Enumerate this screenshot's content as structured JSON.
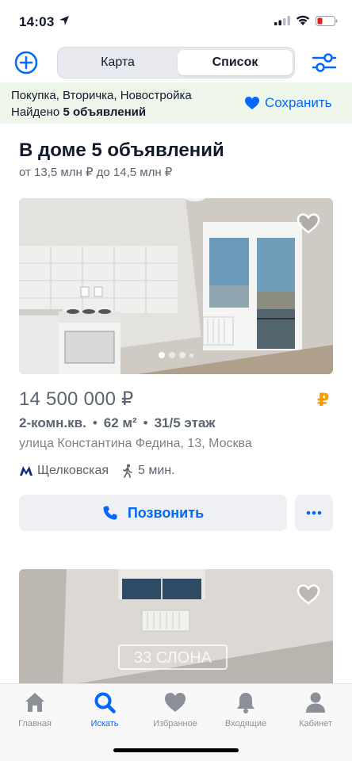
{
  "status_bar": {
    "time": "14:03"
  },
  "header": {
    "tabs": [
      {
        "label": "Карта",
        "active": false
      },
      {
        "label": "Список",
        "active": true
      }
    ]
  },
  "filters": {
    "summary": "Покупка, Вторичка, Новостройка",
    "found_prefix": "Найдено",
    "found_count": "5 объявлений",
    "save_label": "Сохранить"
  },
  "house": {
    "title": "В доме 5 объявлений",
    "price_range": "от 13,5 млн ₽ до 14,5 млн ₽"
  },
  "listing": {
    "price": "14 500 000 ₽",
    "rooms": "2-комн.кв.",
    "area": "62 м²",
    "floor": "31/5 этаж",
    "address": "улица Константина Федина, 13, Москва",
    "metro_station": "Щелковская",
    "walk_time": "5 мин.",
    "call_label": "Позвонить",
    "ruble_badge": "₽",
    "photo_watermark": "33 СЛОНА"
  },
  "tabbar": {
    "items": [
      {
        "label": "Главная",
        "icon": "home-icon",
        "active": false
      },
      {
        "label": "Искать",
        "icon": "search-icon",
        "active": true
      },
      {
        "label": "Избранное",
        "icon": "heart-icon",
        "active": false
      },
      {
        "label": "Входящие",
        "icon": "bell-icon",
        "active": false
      },
      {
        "label": "Кабинет",
        "icon": "person-icon",
        "active": false
      }
    ]
  },
  "colors": {
    "accent": "#0468ff",
    "filter_strip_bg": "#eef6ec",
    "ruble_badge": "#ff9900",
    "text_primary": "#121a2b",
    "text_secondary": "#5c6470"
  }
}
